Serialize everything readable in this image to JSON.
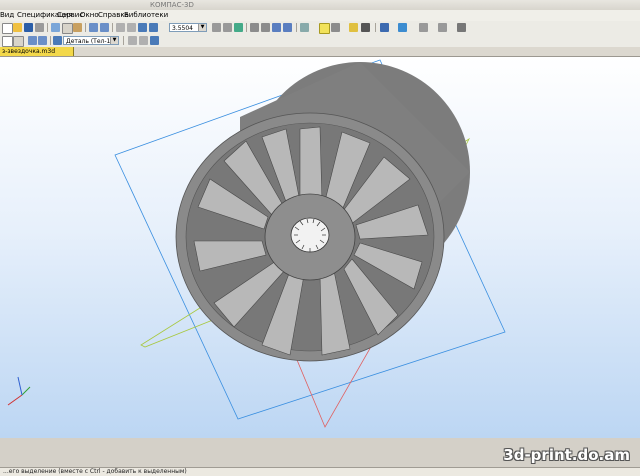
{
  "window": {
    "title": "КОМПАС-3D"
  },
  "menu": {
    "items": [
      "Вид",
      "Спецификация",
      "Сервис",
      "Окно",
      "Справка",
      "Библиотеки"
    ]
  },
  "toolbar": {
    "zoom_value": "3.5504",
    "part_selector": "Деталь (Тел-1)"
  },
  "document_tab": {
    "label": "з-звездочка.m3d"
  },
  "status": {
    "hint": "...его выделение (вместе с Ctrl - добавить к выделенным)"
  },
  "watermark": {
    "text": "3d-print.do.am"
  },
  "colors": {
    "viewport_top": "#ffffff",
    "viewport_bottom": "#bcd6f3",
    "model_gray": "#8f8f8f",
    "plane_blue": "#3a8fe0",
    "plane_green": "#a8c840",
    "plane_red": "#e06060",
    "tab_active": "#f3d84a"
  }
}
